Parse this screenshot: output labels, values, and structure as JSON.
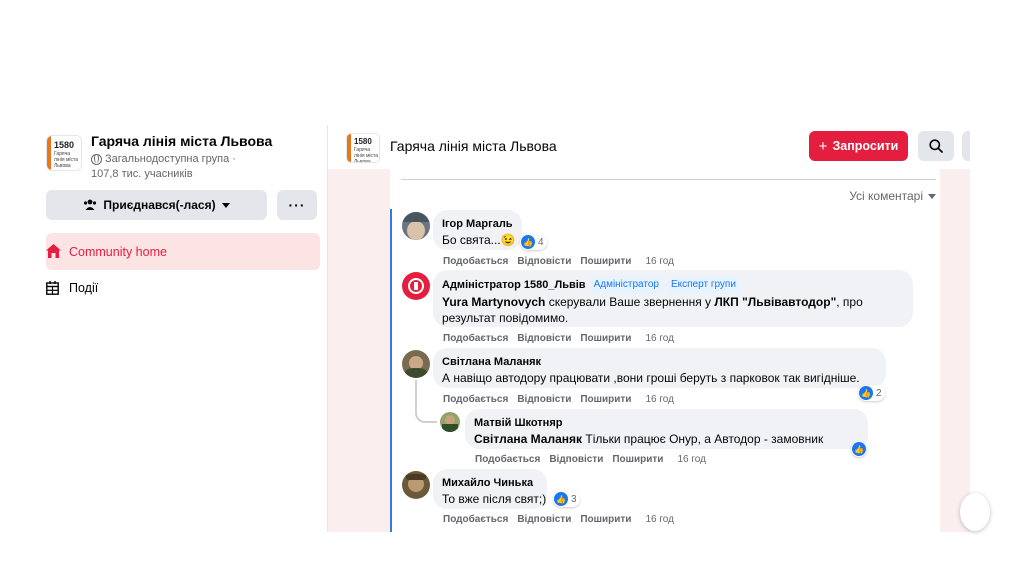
{
  "group": {
    "logo_number": "1580",
    "logo_subtitle": "Гаряча лінія міста Львова",
    "name": "Гаряча лінія міста Львова",
    "privacy": "Загальнодоступна група ·",
    "members": "107,8 тис. учасників",
    "joined_label": "Приєднався(-лася)",
    "more_label": "···"
  },
  "nav": {
    "home": "Community home",
    "events": "Події"
  },
  "topbar": {
    "title": "Гаряча лінія міста Львова",
    "invite_label": "Запросити",
    "invite_prefix": "+"
  },
  "feed": {
    "sort_label": "Усі коментарі",
    "actions": {
      "like": "Подобається",
      "reply": "Відповісти",
      "share": "Поширити"
    },
    "comments": [
      {
        "author": "Ігор Маргаль",
        "text": "Бо свята...",
        "emoji": "😉",
        "likes": "4",
        "time": "16 год"
      },
      {
        "author": "Адміністратор 1580_Львів",
        "badge_admin": "Адміністратор",
        "badge_expert": "Експерт групи",
        "mention": "Yura Martynovych",
        "text_before": " скерували Ваше звернення у ",
        "org": "ЛКП \"Львівавтодор\"",
        "text_after": ", про",
        "line2": "результат повідомимо.",
        "time": "16 год"
      },
      {
        "author": "Світлана Маланяк",
        "text": "А навіщо автодору працювати ,вони гроші беруть з парковок так вигідніше.",
        "likes": "2",
        "time": "16 год"
      },
      {
        "author": "Матвій Шкотняр",
        "mention": "Світлана Маланяк",
        "text": " Тільки працює Онур, а Автодор - замовник",
        "time": "16 год"
      },
      {
        "author": "Михайло Чинька",
        "text": "То вже після свят;)",
        "likes": "3",
        "time": "16 год"
      }
    ]
  },
  "colors": {
    "accent": "#e41e3f",
    "link": "#1877f2",
    "bubble": "#f0f2f5"
  }
}
